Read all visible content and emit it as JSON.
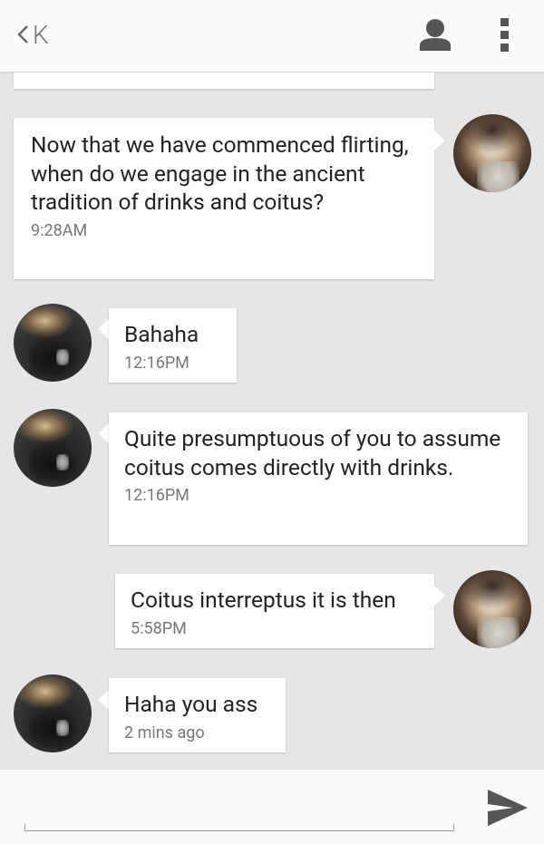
{
  "header": {
    "back_icon": "chevron-left-icon",
    "title": "K",
    "contact_icon": "person-icon",
    "menu_icon": "more-vertical-icon"
  },
  "colors": {
    "background": "#e6e6e6",
    "bubble": "#ffffff",
    "header": "#fafafa",
    "icon": "#555555",
    "timestamp": "#777777"
  },
  "messages": [
    {
      "sender": "me",
      "text": "Now that we have commenced flirting, when do we engage in the ancient tradition of drinks and coitus?",
      "time": "9:28AM"
    },
    {
      "sender": "them",
      "text": "Bahaha",
      "time": "12:16PM"
    },
    {
      "sender": "them",
      "text": "Quite presumptuous of you to assume coitus comes directly with drinks.",
      "time": "12:16PM"
    },
    {
      "sender": "me",
      "text": "Coitus interreptus it is then",
      "time": "5:58PM"
    },
    {
      "sender": "them",
      "text": "Haha you ass",
      "time": "2 mins ago"
    }
  ],
  "compose": {
    "input_value": "",
    "placeholder": "",
    "send_icon": "send-icon"
  }
}
